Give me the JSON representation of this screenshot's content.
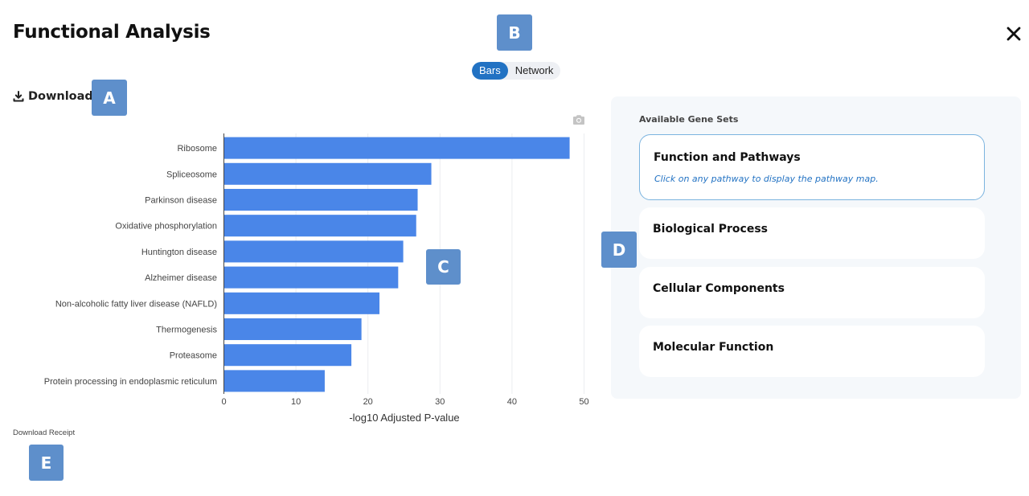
{
  "header": {
    "title": "Functional Analysis"
  },
  "view_toggle": {
    "options": [
      "Bars",
      "Network"
    ],
    "selected": "Bars"
  },
  "download": {
    "label": "Download",
    "icon": "download-icon"
  },
  "receipt": {
    "label": "Download Receipt"
  },
  "markers": [
    "A",
    "B",
    "C",
    "D",
    "E"
  ],
  "gene_sets": {
    "title": "Available Gene Sets",
    "cards": [
      {
        "title": "Function and Pathways",
        "subtitle": "Click on any pathway to display the pathway map.",
        "selected": true
      },
      {
        "title": "Biological Process",
        "subtitle": "",
        "selected": false
      },
      {
        "title": "Cellular Components",
        "subtitle": "",
        "selected": false
      },
      {
        "title": "Molecular Function",
        "subtitle": "",
        "selected": false
      }
    ]
  },
  "colors": {
    "bar": "#4a86e8",
    "accent": "#2272c3",
    "marker": "#5e8fcb",
    "panel_bg": "#f5f8fb"
  },
  "chart_data": {
    "type": "bar",
    "orientation": "horizontal",
    "categories": [
      "Ribosome",
      "Spliceosome",
      "Parkinson disease",
      "Oxidative phosphorylation",
      "Huntington disease",
      "Alzheimer disease",
      "Non-alcoholic fatty liver disease (NAFLD)",
      "Thermogenesis",
      "Proteasome",
      "Protein processing in endoplasmic reticulum"
    ],
    "values": [
      48.0,
      28.8,
      26.9,
      26.7,
      24.9,
      24.2,
      21.6,
      19.1,
      17.7,
      14.0
    ],
    "xlabel": "-log10 Adjusted P-value",
    "xlim": [
      0,
      50
    ],
    "xticks": [
      0,
      10,
      20,
      30,
      40,
      50
    ],
    "grid": true
  }
}
